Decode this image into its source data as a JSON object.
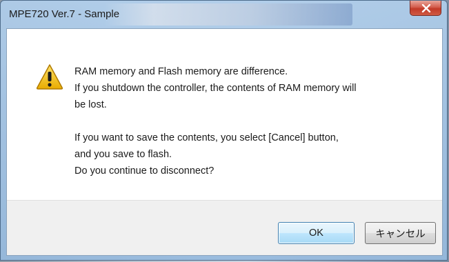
{
  "window": {
    "title": "MPE720 Ver.7 - Sample"
  },
  "icons": {
    "close": "close-icon",
    "warning": "warning-icon"
  },
  "colors": {
    "close_button": "#c23a28",
    "default_button_border": "#3c7fb1",
    "warning_yellow": "#f5c400"
  },
  "message": {
    "line1": "RAM memory and Flash memory are difference.",
    "line2": "If you shutdown the controller, the contents of RAM memory will",
    "line3": "be lost.",
    "line4": "If you want to save the contents, you select [Cancel] button,",
    "line5": "and you save to flash.",
    "line6": "Do you continue to disconnect?"
  },
  "buttons": {
    "ok_label": "OK",
    "cancel_label": "キャンセル"
  }
}
